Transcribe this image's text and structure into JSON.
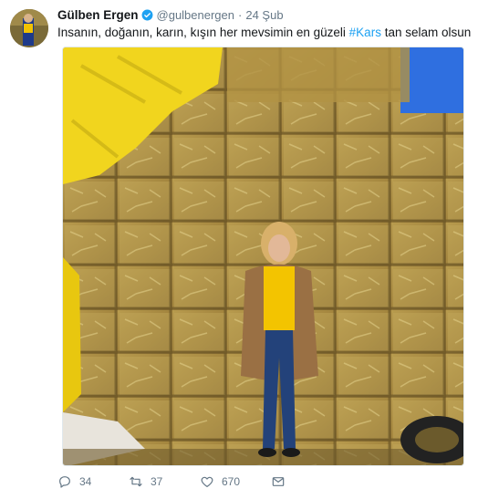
{
  "tweet": {
    "author_name": "Gülben Ergen",
    "handle": "@gulbenergen",
    "separator": "·",
    "date": "24 Şub",
    "text_before": "Insanın, doğanın, karın, kışın her mevsimin en güzeli ",
    "hashtag": "#Kars",
    "text_after": " tan selam olsun",
    "reply_count": "34",
    "retweet_count": "37",
    "like_count": "670"
  },
  "icons": {
    "verified": "verified-badge-icon",
    "reply": "reply-icon",
    "retweet": "retweet-icon",
    "like": "heart-icon",
    "message": "envelope-icon"
  },
  "colors": {
    "link": "#1da1f2",
    "text": "#14171a",
    "secondary": "#657786"
  }
}
